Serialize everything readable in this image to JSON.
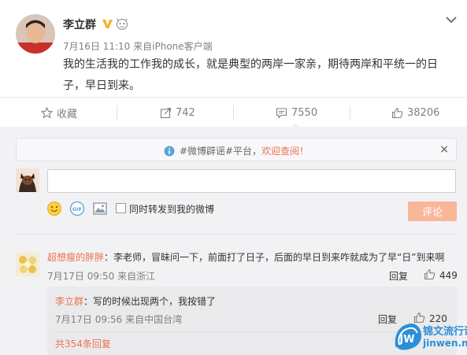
{
  "post": {
    "author": "李立群",
    "date": "7月16日 11:10",
    "source_prefix": "来自",
    "source": "iPhone客户端",
    "text": "我的生活我的工作我的成长，就是典型的两岸一家亲，期待两岸和平统一的日子，早日到来。",
    "icons": {
      "verified": "verified-v-icon",
      "vip": "vip-badge-icon",
      "menu": "chevron-down-icon"
    }
  },
  "actions": {
    "favorite": {
      "label": "收藏",
      "icon": "star-icon"
    },
    "repost": {
      "count": "742",
      "icon": "share-icon"
    },
    "comment": {
      "count": "7550",
      "icon": "comment-icon"
    },
    "like": {
      "count": "38206",
      "icon": "thumb-up-icon"
    }
  },
  "comment_box": {
    "notice_text": "#微博辟谣#平台，",
    "notice_highlight": "欢迎查阅！",
    "notice_close": "×",
    "input_placeholder": "",
    "forward_label": "同时转发到我的微博",
    "submit_label": "评论",
    "tools": [
      "emoji-icon",
      "gif-icon",
      "image-icon"
    ]
  },
  "comment": {
    "user": "超想瘦的胖胖",
    "text": "：李老师，冒昧问一下，前面打了日子，后面的早日到来咋就成为了早“日”到来啊",
    "time": "7月17日 09:50 来自浙江",
    "reply_label": "回复",
    "likes": "449"
  },
  "reply": {
    "user": "李立群",
    "text": "：写的时候出现两个，我按错了",
    "time": "7月17日 09:56 来自中国台湾",
    "reply_label": "回复",
    "likes": "220",
    "total_label": "共354条回复"
  },
  "watermark": {
    "cn": "锦文流行语",
    "url": "jinwen.net",
    "logo_text": "JW"
  },
  "colors": {
    "accent": "#eb7350",
    "submit_bg": "#f7b798",
    "comment_bg": "#f2f2f5",
    "reply_bg": "#eaeaec",
    "verify_gold": "#f6b221"
  }
}
